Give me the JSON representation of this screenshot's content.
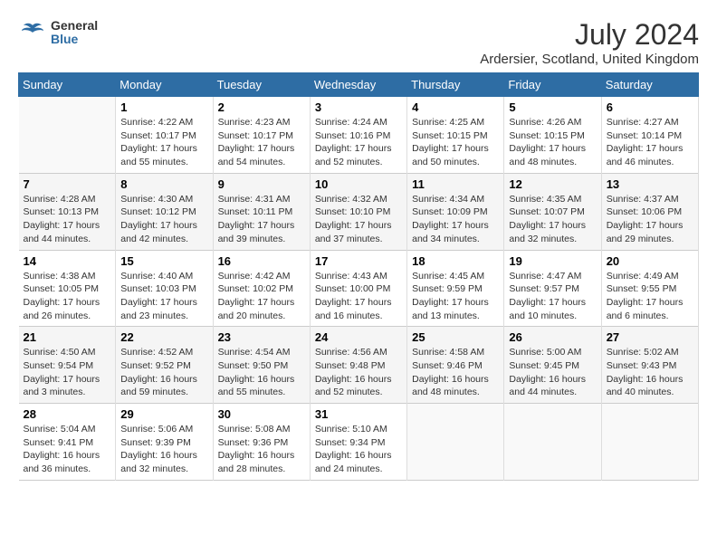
{
  "logo": {
    "general": "General",
    "blue": "Blue"
  },
  "title": "July 2024",
  "location": "Ardersier, Scotland, United Kingdom",
  "days_of_week": [
    "Sunday",
    "Monday",
    "Tuesday",
    "Wednesday",
    "Thursday",
    "Friday",
    "Saturday"
  ],
  "weeks": [
    [
      {
        "day": "",
        "info": ""
      },
      {
        "day": "1",
        "info": "Sunrise: 4:22 AM\nSunset: 10:17 PM\nDaylight: 17 hours\nand 55 minutes."
      },
      {
        "day": "2",
        "info": "Sunrise: 4:23 AM\nSunset: 10:17 PM\nDaylight: 17 hours\nand 54 minutes."
      },
      {
        "day": "3",
        "info": "Sunrise: 4:24 AM\nSunset: 10:16 PM\nDaylight: 17 hours\nand 52 minutes."
      },
      {
        "day": "4",
        "info": "Sunrise: 4:25 AM\nSunset: 10:15 PM\nDaylight: 17 hours\nand 50 minutes."
      },
      {
        "day": "5",
        "info": "Sunrise: 4:26 AM\nSunset: 10:15 PM\nDaylight: 17 hours\nand 48 minutes."
      },
      {
        "day": "6",
        "info": "Sunrise: 4:27 AM\nSunset: 10:14 PM\nDaylight: 17 hours\nand 46 minutes."
      }
    ],
    [
      {
        "day": "7",
        "info": "Sunrise: 4:28 AM\nSunset: 10:13 PM\nDaylight: 17 hours\nand 44 minutes."
      },
      {
        "day": "8",
        "info": "Sunrise: 4:30 AM\nSunset: 10:12 PM\nDaylight: 17 hours\nand 42 minutes."
      },
      {
        "day": "9",
        "info": "Sunrise: 4:31 AM\nSunset: 10:11 PM\nDaylight: 17 hours\nand 39 minutes."
      },
      {
        "day": "10",
        "info": "Sunrise: 4:32 AM\nSunset: 10:10 PM\nDaylight: 17 hours\nand 37 minutes."
      },
      {
        "day": "11",
        "info": "Sunrise: 4:34 AM\nSunset: 10:09 PM\nDaylight: 17 hours\nand 34 minutes."
      },
      {
        "day": "12",
        "info": "Sunrise: 4:35 AM\nSunset: 10:07 PM\nDaylight: 17 hours\nand 32 minutes."
      },
      {
        "day": "13",
        "info": "Sunrise: 4:37 AM\nSunset: 10:06 PM\nDaylight: 17 hours\nand 29 minutes."
      }
    ],
    [
      {
        "day": "14",
        "info": "Sunrise: 4:38 AM\nSunset: 10:05 PM\nDaylight: 17 hours\nand 26 minutes."
      },
      {
        "day": "15",
        "info": "Sunrise: 4:40 AM\nSunset: 10:03 PM\nDaylight: 17 hours\nand 23 minutes."
      },
      {
        "day": "16",
        "info": "Sunrise: 4:42 AM\nSunset: 10:02 PM\nDaylight: 17 hours\nand 20 minutes."
      },
      {
        "day": "17",
        "info": "Sunrise: 4:43 AM\nSunset: 10:00 PM\nDaylight: 17 hours\nand 16 minutes."
      },
      {
        "day": "18",
        "info": "Sunrise: 4:45 AM\nSunset: 9:59 PM\nDaylight: 17 hours\nand 13 minutes."
      },
      {
        "day": "19",
        "info": "Sunrise: 4:47 AM\nSunset: 9:57 PM\nDaylight: 17 hours\nand 10 minutes."
      },
      {
        "day": "20",
        "info": "Sunrise: 4:49 AM\nSunset: 9:55 PM\nDaylight: 17 hours\nand 6 minutes."
      }
    ],
    [
      {
        "day": "21",
        "info": "Sunrise: 4:50 AM\nSunset: 9:54 PM\nDaylight: 17 hours\nand 3 minutes."
      },
      {
        "day": "22",
        "info": "Sunrise: 4:52 AM\nSunset: 9:52 PM\nDaylight: 16 hours\nand 59 minutes."
      },
      {
        "day": "23",
        "info": "Sunrise: 4:54 AM\nSunset: 9:50 PM\nDaylight: 16 hours\nand 55 minutes."
      },
      {
        "day": "24",
        "info": "Sunrise: 4:56 AM\nSunset: 9:48 PM\nDaylight: 16 hours\nand 52 minutes."
      },
      {
        "day": "25",
        "info": "Sunrise: 4:58 AM\nSunset: 9:46 PM\nDaylight: 16 hours\nand 48 minutes."
      },
      {
        "day": "26",
        "info": "Sunrise: 5:00 AM\nSunset: 9:45 PM\nDaylight: 16 hours\nand 44 minutes."
      },
      {
        "day": "27",
        "info": "Sunrise: 5:02 AM\nSunset: 9:43 PM\nDaylight: 16 hours\nand 40 minutes."
      }
    ],
    [
      {
        "day": "28",
        "info": "Sunrise: 5:04 AM\nSunset: 9:41 PM\nDaylight: 16 hours\nand 36 minutes."
      },
      {
        "day": "29",
        "info": "Sunrise: 5:06 AM\nSunset: 9:39 PM\nDaylight: 16 hours\nand 32 minutes."
      },
      {
        "day": "30",
        "info": "Sunrise: 5:08 AM\nSunset: 9:36 PM\nDaylight: 16 hours\nand 28 minutes."
      },
      {
        "day": "31",
        "info": "Sunrise: 5:10 AM\nSunset: 9:34 PM\nDaylight: 16 hours\nand 24 minutes."
      },
      {
        "day": "",
        "info": ""
      },
      {
        "day": "",
        "info": ""
      },
      {
        "day": "",
        "info": ""
      }
    ]
  ]
}
